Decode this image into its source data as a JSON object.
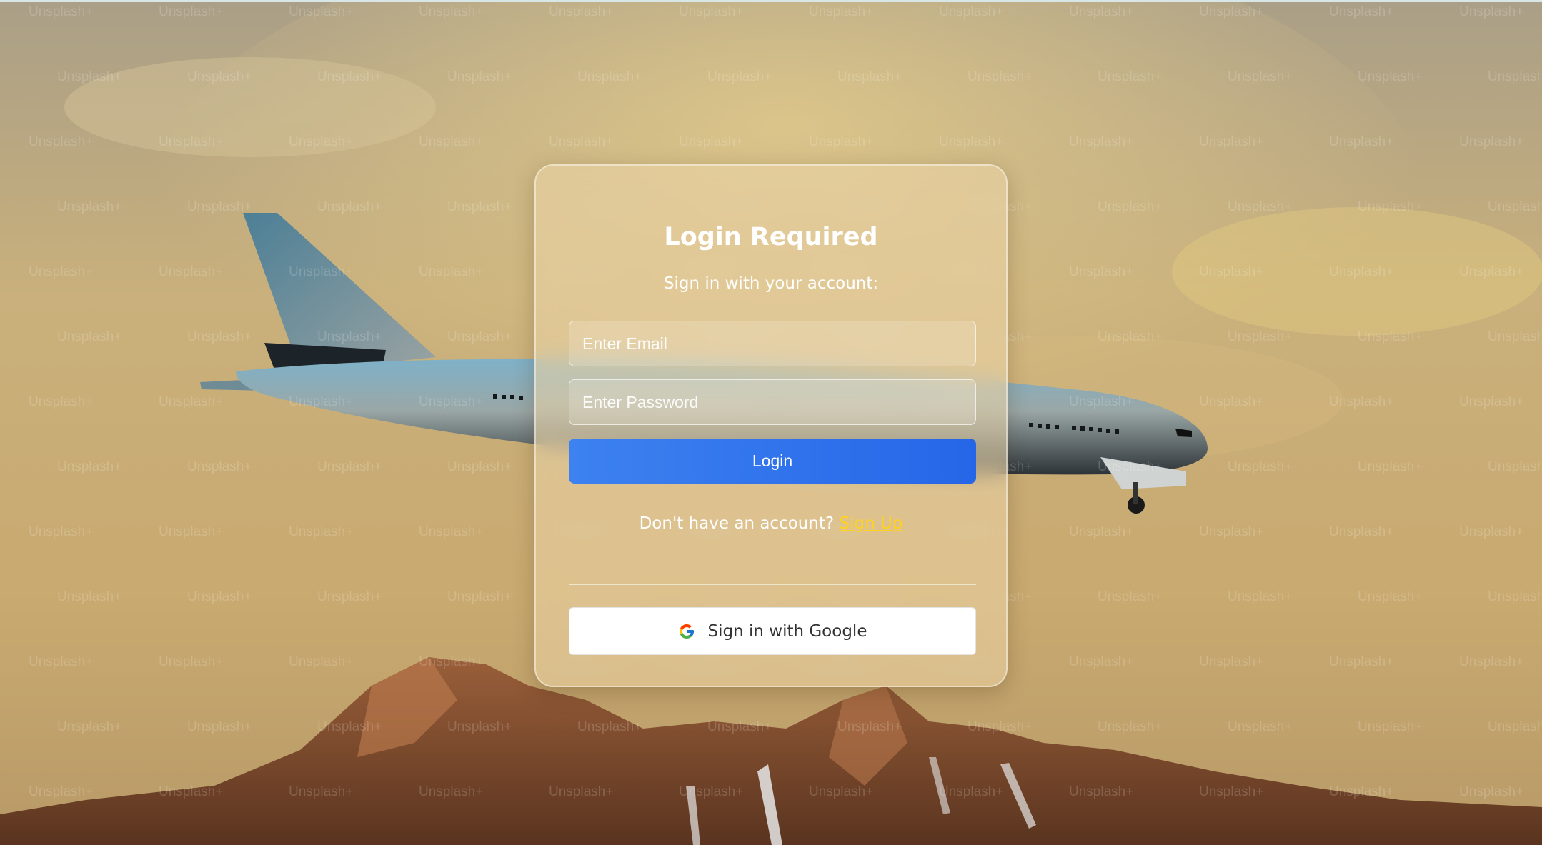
{
  "background": {
    "watermark_text": "Unsplash+",
    "sky_color": "#c9ab72",
    "mountain_color": "#7a4a2c"
  },
  "login_card": {
    "title": "Login Required",
    "subtitle": "Sign in with your account:",
    "email_placeholder": "Enter Email",
    "password_placeholder": "Enter Password",
    "login_label": "Login",
    "signup_prompt": "Don't have an account?",
    "signup_link": "Sign Up",
    "google_label": "Sign in with Google",
    "google_icon": "google-g-icon"
  },
  "colors": {
    "primary_button": "#2f73ee",
    "link": "#ffd21c",
    "card_bg": "rgba(236,214,168,0.55)"
  }
}
